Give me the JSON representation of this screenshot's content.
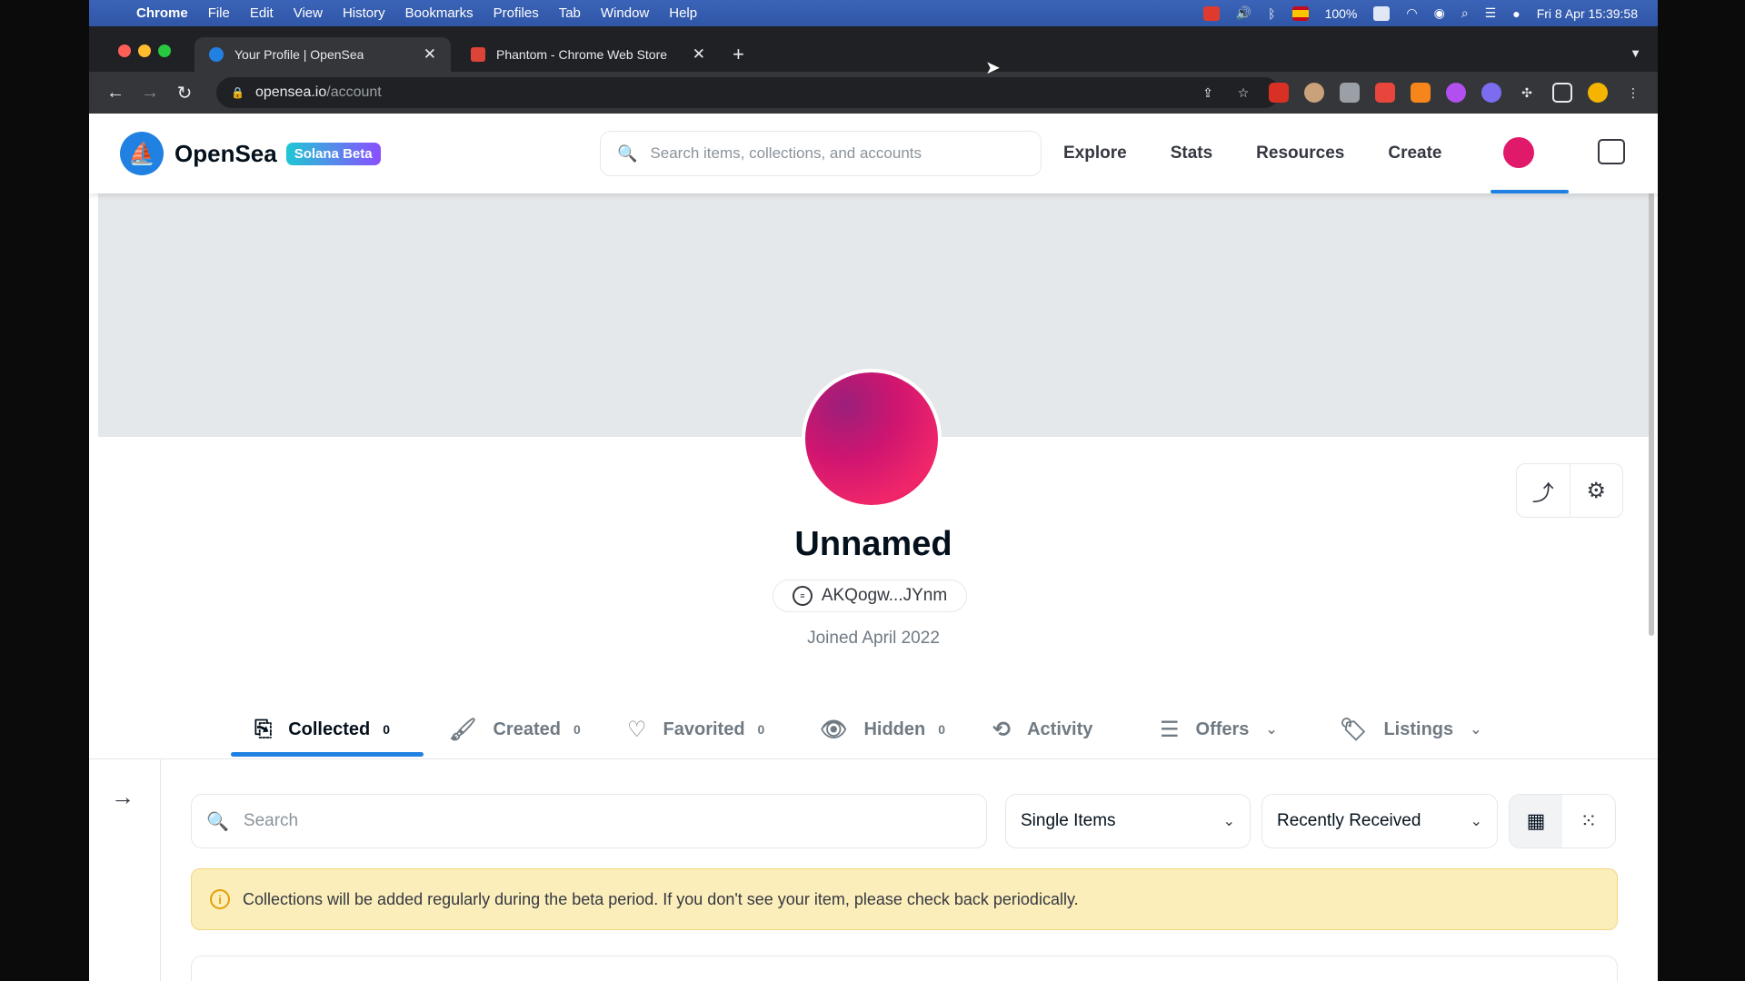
{
  "menubar": {
    "app": "Chrome",
    "items": [
      "File",
      "Edit",
      "View",
      "History",
      "Bookmarks",
      "Profiles",
      "Tab",
      "Window",
      "Help"
    ],
    "battery": "100%",
    "datetime": "Fri 8 Apr  15:39:58"
  },
  "browser": {
    "tabs": [
      {
        "title": "Your Profile | OpenSea"
      },
      {
        "title": "Phantom - Chrome Web Store"
      }
    ],
    "url_host": "opensea.io",
    "url_path": "/account"
  },
  "header": {
    "brand": "OpenSea",
    "badge": "Solana Beta",
    "search_placeholder": "Search items, collections, and accounts",
    "nav": [
      "Explore",
      "Stats",
      "Resources",
      "Create"
    ]
  },
  "profile": {
    "name": "Unnamed",
    "address": "AKQogw...JYnm",
    "joined": "Joined April 2022",
    "avatar_color": "#e0196b"
  },
  "tabs": [
    {
      "label": "Collected",
      "count": "0"
    },
    {
      "label": "Created",
      "count": "0"
    },
    {
      "label": "Favorited",
      "count": "0"
    },
    {
      "label": "Hidden",
      "count": "0"
    },
    {
      "label": "Activity"
    },
    {
      "label": "Offers"
    },
    {
      "label": "Listings"
    }
  ],
  "filters": {
    "search_placeholder": "Search",
    "item_type": "Single Items",
    "sort": "Recently Received"
  },
  "notice": {
    "text": "Collections will be added regularly during the beta period. If you don't see your item, please check back periodically."
  },
  "colors": {
    "accent": "#2081e2",
    "notice_bg": "#fbeebb"
  }
}
